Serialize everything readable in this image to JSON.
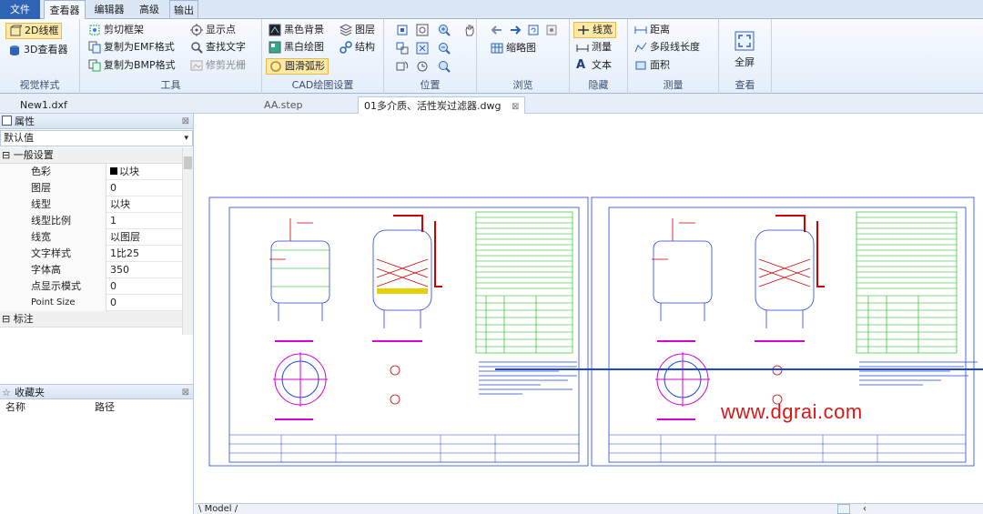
{
  "ribbon_tabs": [
    "文件",
    "查看器",
    "编辑器",
    "高级",
    "输出"
  ],
  "groups": {
    "visual_style": {
      "label": "视觉样式",
      "items": [
        "2D线框",
        "3D查看器"
      ]
    },
    "tools": {
      "label": "工具",
      "items": [
        "剪切框架",
        "复制为EMF格式",
        "复制为BMP格式",
        "显示点",
        "查找文字",
        "修剪光栅"
      ]
    },
    "cad_settings": {
      "label": "CAD绘图设置",
      "items": [
        "黑色背景",
        "黑白绘图",
        "圆滑弧形",
        "图层",
        "结构"
      ]
    },
    "position": {
      "label": "位置"
    },
    "browse": {
      "label": "浏览",
      "items": [
        "缩略图"
      ]
    },
    "hide": {
      "label": "隐藏",
      "items": [
        "线宽",
        "测量",
        "文本"
      ]
    },
    "measure": {
      "label": "测量",
      "items": [
        "距离",
        "多段线长度",
        "面积"
      ]
    },
    "view": {
      "label": "查看",
      "items": [
        "全屏"
      ]
    }
  },
  "doc_tabs": [
    "New1.dxf",
    "AA.step",
    "01多介质、活性炭过滤器.dwg"
  ],
  "properties": {
    "title": "属性",
    "selector": "默认值",
    "section_general": "一般设置",
    "rows": [
      {
        "name": "色彩",
        "value": "以块"
      },
      {
        "name": "图层",
        "value": "0"
      },
      {
        "name": "线型",
        "value": "以块"
      },
      {
        "name": "线型比例",
        "value": "1"
      },
      {
        "name": "线宽",
        "value": "以图层"
      },
      {
        "name": "文字样式",
        "value": "1比25"
      },
      {
        "name": "字体高",
        "value": "350"
      },
      {
        "name": "点显示模式",
        "value": "0"
      },
      {
        "name": "Point Size",
        "value": "0"
      }
    ],
    "section_annotation": "标注"
  },
  "favorites": {
    "title": "收藏夹",
    "col_name": "名称",
    "col_path": "路径"
  },
  "status": {
    "model_tab": "Model"
  },
  "watermark": "www.dgrai.com",
  "colors": {
    "accent": "#2e63b5",
    "selected": "#fde9a8",
    "cad_blue": "#2244dd",
    "cad_green": "#00c000",
    "cad_magenta": "#d400d4",
    "cad_red": "#d00000"
  }
}
